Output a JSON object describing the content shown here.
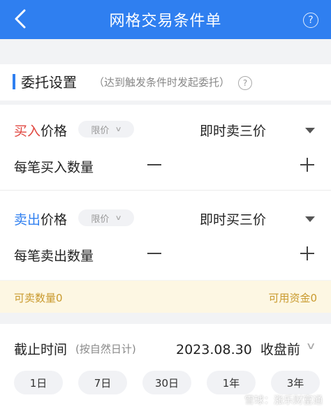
{
  "header": {
    "title": "网格交易条件单",
    "help_icon": "question-circle-icon"
  },
  "section": {
    "title": "委托设置",
    "subtitle": "（达到触发条件时发起委托）"
  },
  "buy": {
    "label_colored": "买入",
    "label_rest": "价格",
    "price_type": "限价",
    "price_value": "即时卖三价",
    "qty_label": "每笔买入数量"
  },
  "sell": {
    "label_colored": "卖出",
    "label_rest": "价格",
    "price_type": "限价",
    "price_value": "即时买三价",
    "qty_label": "每笔卖出数量"
  },
  "tips": {
    "sellable": "可卖数量0",
    "available_funds": "可用资金0"
  },
  "deadline": {
    "label": "截止时间",
    "sub": "(按自然日计)",
    "date": "2023.08.30",
    "time": "收盘前",
    "options": [
      "1日",
      "7日",
      "30日",
      "1年",
      "3年"
    ]
  },
  "watermark": {
    "text": "雪球：涨乐财富通"
  },
  "colors": {
    "accent": "#2f7ff0",
    "buy": "#e0463f",
    "sell": "#2f7ff0",
    "tip": "#c99a2e"
  }
}
